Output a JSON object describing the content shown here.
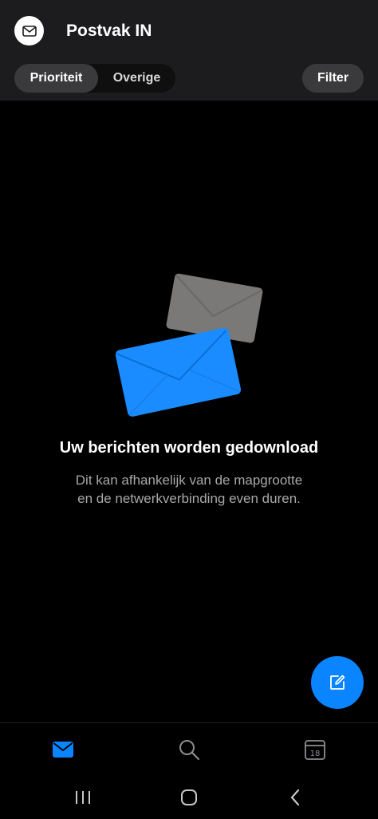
{
  "header": {
    "title": "Postvak IN",
    "avatar_icon": "mail-icon",
    "tabs": [
      {
        "label": "Prioriteit",
        "active": true
      },
      {
        "label": "Overige",
        "active": false
      }
    ],
    "filter_label": "Filter"
  },
  "empty_state": {
    "title": "Uw berichten worden gedownload",
    "subtitle_line1": "Dit kan afhankelijk van de mapgrootte",
    "subtitle_line2": "en de netwerkverbinding even duren.",
    "illustration_icon": "envelopes-illustration"
  },
  "fab": {
    "icon": "compose-icon"
  },
  "bottom_nav": {
    "items": [
      {
        "icon": "mail-icon",
        "active": true
      },
      {
        "icon": "search-icon",
        "active": false
      },
      {
        "icon": "calendar-icon",
        "active": false,
        "day": "18"
      }
    ]
  },
  "system_nav": {
    "items": [
      {
        "icon": "recent-apps-icon"
      },
      {
        "icon": "home-icon"
      },
      {
        "icon": "back-icon"
      }
    ]
  },
  "colors": {
    "accent": "#0a84ff",
    "header_bg": "#1c1c1e",
    "background": "#000000",
    "secondary_text": "#a8a8a8",
    "inactive_icon": "#8e8e93"
  }
}
